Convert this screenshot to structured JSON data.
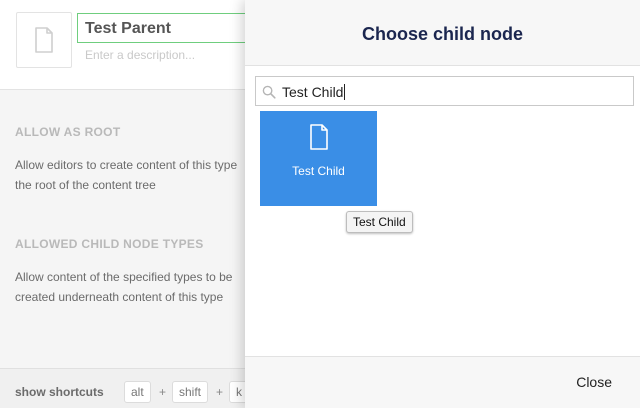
{
  "editor": {
    "name_value": "Test Parent",
    "description_placeholder": "Enter a description...",
    "allow_root": {
      "title": "ALLOW AS ROOT",
      "line1": "Allow editors to create content of this type",
      "line2": "the root of the content tree"
    },
    "allowed_children": {
      "title": "ALLOWED CHILD NODE TYPES",
      "line1": "Allow content of the specified types to be",
      "line2": "created underneath content of this type"
    },
    "footer": {
      "label": "show shortcuts",
      "keys": [
        "alt",
        "shift",
        "k"
      ],
      "plus": "+"
    }
  },
  "dialog": {
    "title": "Choose child node",
    "search_value": "Test Child",
    "nodes": [
      {
        "label": "Test Child",
        "icon": "document-icon"
      }
    ],
    "tooltip": "Test Child",
    "close_label": "Close"
  },
  "colors": {
    "tile_blue": "#3a8ee6",
    "title_navy": "#1b264f",
    "input_border_green": "#6fce7e"
  }
}
